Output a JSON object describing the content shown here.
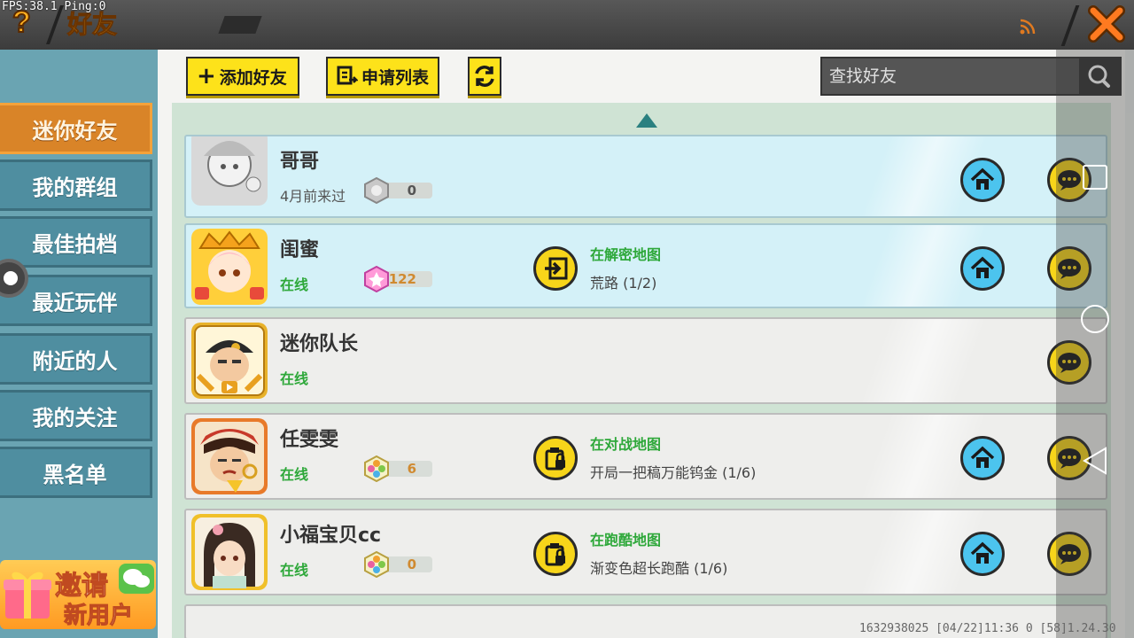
{
  "header": {
    "debug": "FPS:38.1  Ping:0",
    "title": "好友"
  },
  "toolbar": {
    "add_friend": "添加好友",
    "request_list": "申请列表",
    "search_placeholder": "查找好友"
  },
  "sidebar": {
    "tabs": [
      {
        "label": "迷你好友",
        "active": true
      },
      {
        "label": "我的群组",
        "active": false
      },
      {
        "label": "最佳拍档",
        "active": false
      },
      {
        "label": "最近玩伴",
        "active": false
      },
      {
        "label": "附近的人",
        "active": false
      },
      {
        "label": "我的关注",
        "active": false
      },
      {
        "label": "黑名单",
        "active": false
      }
    ],
    "invite": {
      "line1": "邀请",
      "line2": "新用户"
    }
  },
  "friends": [
    {
      "name": "哥哥",
      "status": "4月前来过",
      "badge": "0",
      "map_status": "",
      "map_name": ""
    },
    {
      "name": "闺蜜",
      "status": "在线",
      "badge": "122",
      "map_status": "在解密地图",
      "map_name": "荒路 (1/2)"
    },
    {
      "name": "迷你队长",
      "status": "在线",
      "badge": "",
      "map_status": "",
      "map_name": ""
    },
    {
      "name": "任雯雯",
      "status": "在线",
      "badge": "6",
      "map_status": "在对战地图",
      "map_name": "开局一把稿万能钨金 (1/6)"
    },
    {
      "name": "小福宝贝cc",
      "status": "在线",
      "badge": "0",
      "map_status": "在跑酷地图",
      "map_name": "渐变色超长跑酷 (1/6)"
    }
  ],
  "footer": {
    "text": "1632938025   [04/22]11:36 0  [58]1.24.30"
  },
  "colors": {
    "accent_yellow": "#fde21a",
    "tab_active": "#d98428",
    "online_green": "#2ea83a",
    "home_blue": "#4cc4ee"
  }
}
